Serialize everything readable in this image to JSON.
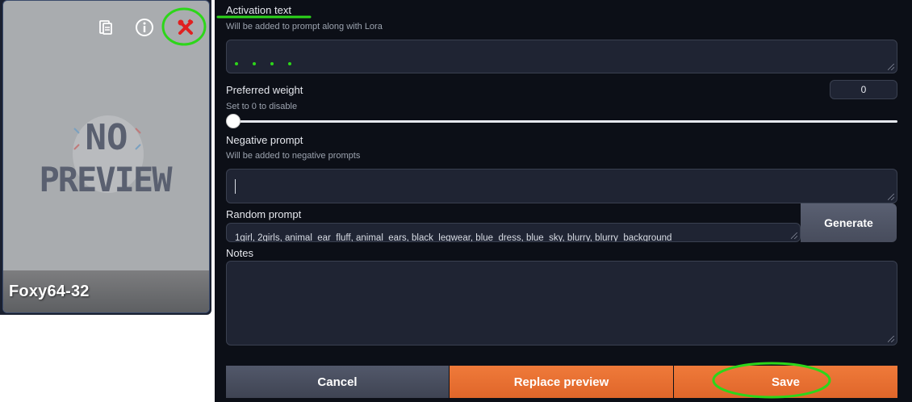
{
  "card": {
    "name": "Foxy64-32",
    "preview_text_line1": "NO",
    "preview_text_line2": "PREVIEW",
    "icons": [
      "copy-path-icon",
      "info-icon",
      "tools-icon"
    ]
  },
  "activation": {
    "label": "Activation text",
    "hint": "Will be added to prompt along with Lora",
    "value": ""
  },
  "weight": {
    "label": "Preferred weight",
    "hint": "Set to 0 to disable",
    "value": "0",
    "slider_fraction": 0
  },
  "negative": {
    "label": "Negative prompt",
    "hint": "Will be added to negative prompts",
    "value": ""
  },
  "random_prompt": {
    "label": "Random prompt",
    "value": "1girl, 2girls, animal_ear_fluff, animal_ears, black_legwear, blue_dress, blue_sky, blurry, blurry_background",
    "generate_label": "Generate"
  },
  "notes": {
    "label": "Notes",
    "value": ""
  },
  "buttons": {
    "cancel": "Cancel",
    "replace_preview": "Replace preview",
    "save": "Save"
  },
  "colors": {
    "accent_orange": "#e8702f",
    "annotation_green": "#2dd61a",
    "panel_bg": "#0c0f17"
  }
}
